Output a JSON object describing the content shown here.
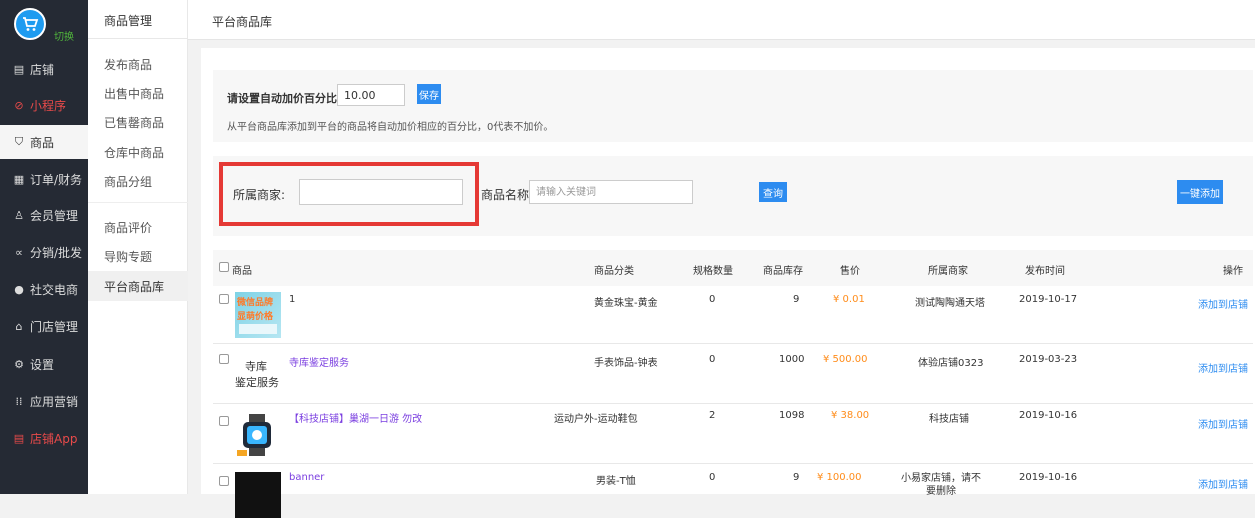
{
  "left_nav": {
    "switch_label": "切换",
    "items": [
      {
        "icon": "store-icon",
        "glyph": "▤",
        "label": "店铺"
      },
      {
        "icon": "miniprogram-icon",
        "glyph": "⊘",
        "label": "小程序"
      },
      {
        "icon": "goods-icon",
        "glyph": "⛉",
        "label": "商品"
      },
      {
        "icon": "order-icon",
        "glyph": "▦",
        "label": "订单/财务"
      },
      {
        "icon": "member-icon",
        "glyph": "♙",
        "label": "会员管理"
      },
      {
        "icon": "distribution-icon",
        "glyph": "∝",
        "label": "分销/批发"
      },
      {
        "icon": "social-icon",
        "glyph": "●",
        "label": "社交电商"
      },
      {
        "icon": "shop-manage-icon",
        "glyph": "⌂",
        "label": "门店管理"
      },
      {
        "icon": "settings-icon",
        "glyph": "⚙",
        "label": "设置"
      },
      {
        "icon": "apps-icon",
        "glyph": "⁞⁞",
        "label": "应用营销"
      },
      {
        "icon": "app-icon",
        "glyph": "▤",
        "label": "店铺App"
      }
    ]
  },
  "sub_nav": {
    "title": "商品管理",
    "items": [
      "发布商品",
      "出售中商品",
      "已售罄商品",
      "仓库中商品",
      "商品分组",
      "商品评价",
      "导购专题",
      "平台商品库"
    ]
  },
  "breadcrumb": "平台商品库",
  "setting": {
    "label": "请设置自动加价百分比",
    "value": "10.00",
    "save_label": "保存",
    "hint": "从平台商品库添加到平台的商品将自动加价相应的百分比，0代表不加价。"
  },
  "filter": {
    "merchant_label": "所属商家:",
    "merchant_value": "",
    "name_label": "商品名称:",
    "name_placeholder": "请输入关键词",
    "query_label": "查询",
    "add_all_label": "一键添加"
  },
  "table": {
    "headers": {
      "product": "商品",
      "category": "商品分类",
      "spec_count": "规格数量",
      "stock": "商品库存",
      "price": "售价",
      "merchant": "所属商家",
      "publish_time": "发布时间",
      "action": "操作"
    },
    "rows": [
      {
        "name": "1",
        "category": "黄金珠宝-黄金",
        "spec_count": "0",
        "stock": "9",
        "price": "¥ 0.01",
        "merchant": "测试陶陶通天塔",
        "date": "2019-10-17",
        "action": "添加到店铺",
        "thumb_text_1": "微信品牌",
        "thumb_text_2": "显萌价格"
      },
      {
        "name": "寺库鉴定服务",
        "category": "手表饰品-钟表",
        "spec_count": "0",
        "stock": "1000",
        "price": "¥ 500.00",
        "merchant": "体验店铺0323",
        "date": "2019-03-23",
        "action": "添加到店铺",
        "thumb_text_1": "寺库",
        "thumb_text_2": "鉴定服务"
      },
      {
        "name": "【科技店铺】巢湖一日游 勿改",
        "category": "运动户外-运动鞋包",
        "spec_count": "2",
        "stock": "1098",
        "price": "¥ 38.00",
        "merchant": "科技店铺",
        "date": "2019-10-16",
        "action": "添加到店铺"
      },
      {
        "name": "banner",
        "category": "男装-T恤",
        "spec_count": "0",
        "stock": "9",
        "price": "¥ 100.00",
        "merchant": "小易家店铺，请不要删除",
        "date": "2019-10-16",
        "action": "添加到店铺"
      }
    ]
  }
}
